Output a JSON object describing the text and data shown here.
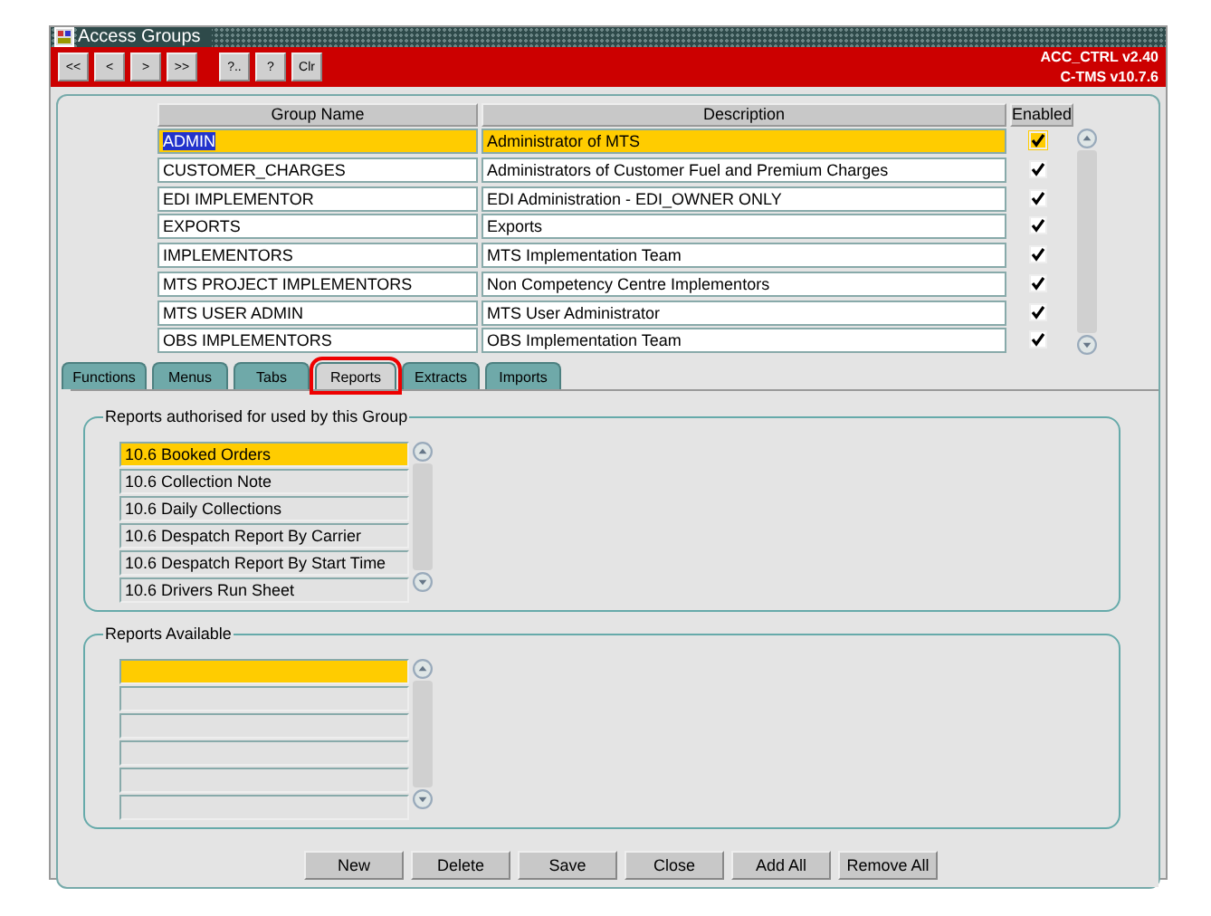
{
  "window": {
    "title": "Access Groups"
  },
  "toolbar": {
    "buttons": [
      "<<",
      "<",
      ">",
      ">>",
      "?..",
      "?",
      "Clr"
    ],
    "version_lines": [
      "ACC_CTRL v2.40",
      "C-TMS v10.7.6"
    ]
  },
  "table": {
    "columns": [
      "Group Name",
      "Description",
      "Enabled"
    ],
    "rows": [
      {
        "group": "ADMIN",
        "description": "Administrator of MTS",
        "enabled": true,
        "selected": true
      },
      {
        "group": "CUSTOMER_CHARGES",
        "description": "Administrators of Customer Fuel and Premium Charges",
        "enabled": true,
        "selected": false
      },
      {
        "group": "EDI IMPLEMENTOR",
        "description": "EDI Administration - EDI_OWNER ONLY",
        "enabled": true,
        "selected": false
      },
      {
        "group": "EXPORTS",
        "description": "Exports",
        "enabled": true,
        "selected": false
      },
      {
        "group": "IMPLEMENTORS",
        "description": "MTS Implementation Team",
        "enabled": true,
        "selected": false
      },
      {
        "group": "MTS PROJECT IMPLEMENTORS",
        "description": "Non Competency Centre Implementors",
        "enabled": true,
        "selected": false
      },
      {
        "group": "MTS USER ADMIN",
        "description": "MTS User Administrator",
        "enabled": true,
        "selected": false
      },
      {
        "group": "OBS IMPLEMENTORS",
        "description": "OBS Implementation Team",
        "enabled": true,
        "selected": false
      }
    ]
  },
  "tabs": [
    {
      "label": "Functions",
      "selected": false
    },
    {
      "label": "Menus",
      "selected": false
    },
    {
      "label": "Tabs",
      "selected": false
    },
    {
      "label": "Reports",
      "selected": true
    },
    {
      "label": "Extracts",
      "selected": false
    },
    {
      "label": "Imports",
      "selected": false
    }
  ],
  "authorised": {
    "title": "Reports authorised for used by this Group",
    "items": [
      {
        "label": "10.6 Booked Orders",
        "selected": true
      },
      {
        "label": "10.6 Collection Note",
        "selected": false
      },
      {
        "label": "10.6 Daily Collections",
        "selected": false
      },
      {
        "label": "10.6 Despatch Report By Carrier",
        "selected": false
      },
      {
        "label": "10.6 Despatch Report By Start Time",
        "selected": false
      },
      {
        "label": "10.6 Drivers Run Sheet",
        "selected": false
      }
    ]
  },
  "available": {
    "title": "Reports Available",
    "items": [
      {
        "selected": true
      },
      {
        "selected": false
      },
      {
        "selected": false
      },
      {
        "selected": false
      },
      {
        "selected": false
      },
      {
        "selected": false
      }
    ]
  },
  "buttons": [
    "New",
    "Delete",
    "Save",
    "Close",
    "Add All",
    "Remove All"
  ]
}
